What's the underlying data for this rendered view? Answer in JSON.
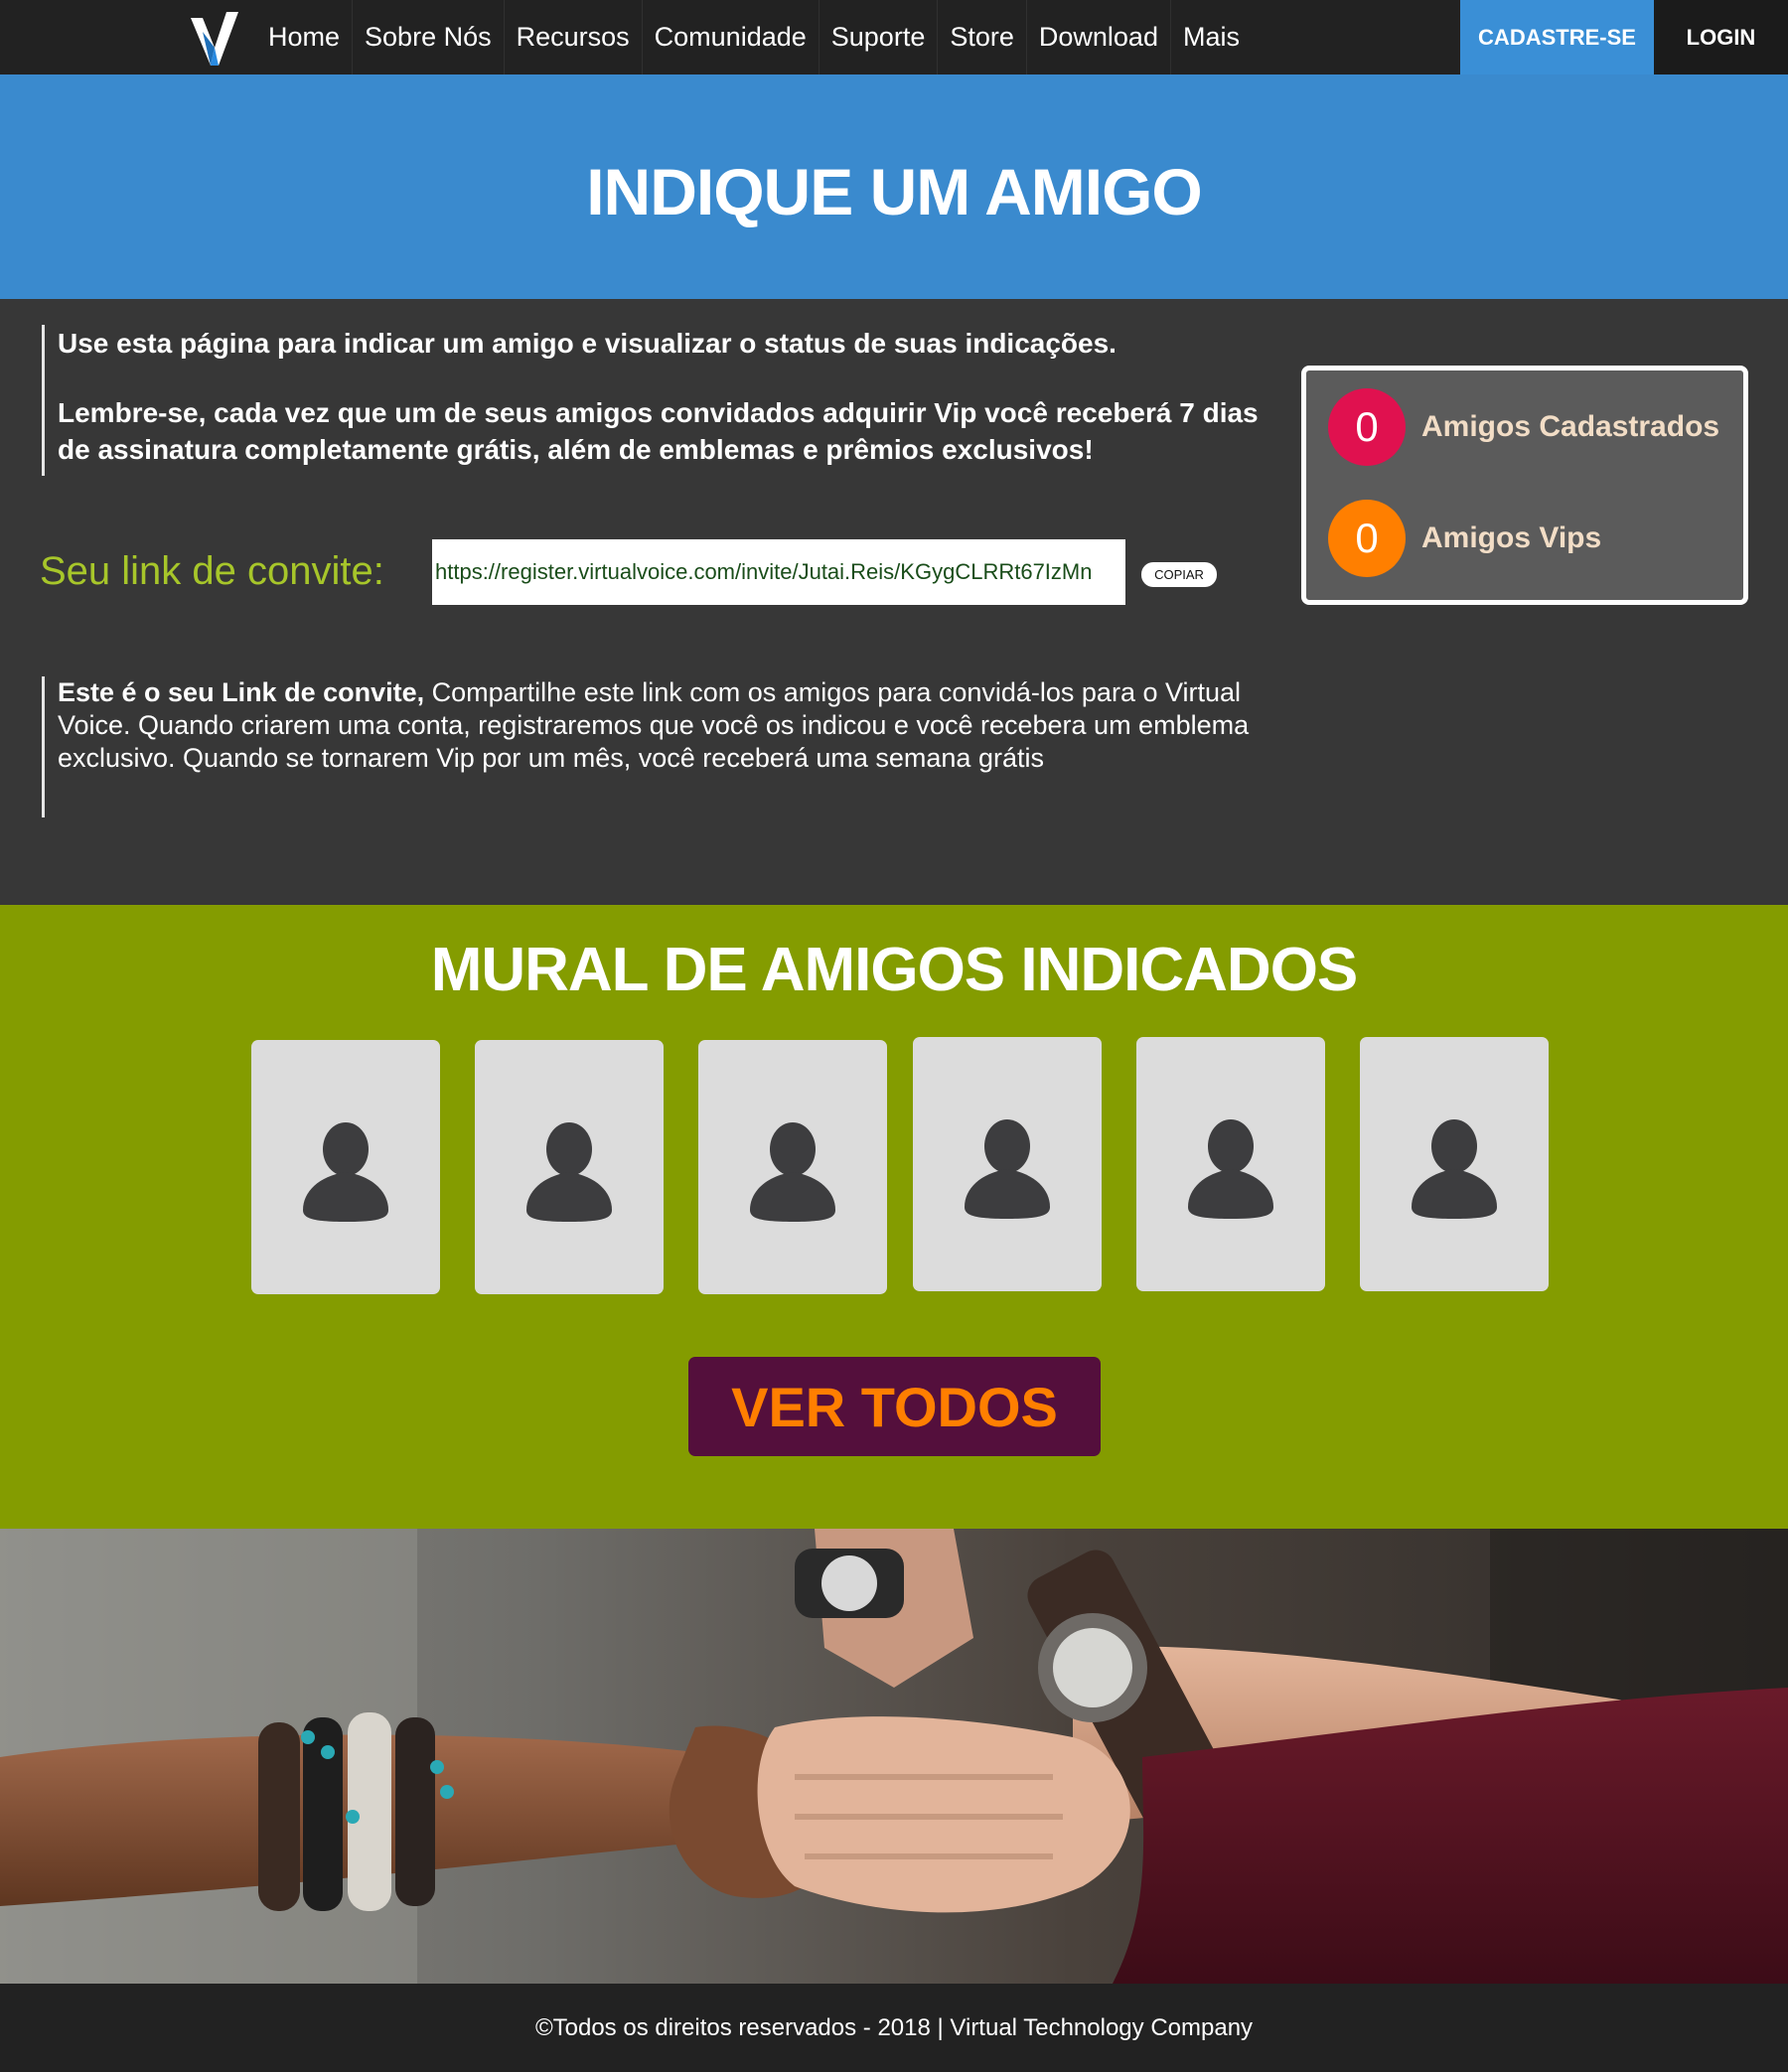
{
  "nav": {
    "items": [
      "Home",
      "Sobre Nós",
      "Recursos",
      "Comunidade",
      "Suporte",
      "Store",
      "Download",
      "Mais"
    ],
    "signup_label": "CADASTRE-SE",
    "login_label": "LOGIN"
  },
  "hero": {
    "title": "INDIQUE UM AMIGO"
  },
  "intro": {
    "line1": "Use esta página para indicar um amigo e visualizar o status de suas indicações.",
    "line2": "Lembre-se, cada vez que um de seus amigos convidados adquirir Vip você receberá 7 dias de assinatura completamente grátis, além de emblemas e prêmios exclusivos!"
  },
  "invite": {
    "label": "Seu link de convite:",
    "url": "https://register.virtualvoice.com/invite/Jutai.Reis/KGygCLRRt67IzMn",
    "copy_label": "COPIAR",
    "note_bold": "Este é o seu Link de convite,",
    "note_text": " Compartilhe este link com os amigos para convidá-los para o Virtual Voice. Quando criarem uma conta, registraremos que você os indicou e você recebera um emblema exclusivo. Quando se tornarem Vip por um mês, você receberá uma semana grátis"
  },
  "stats": {
    "registered": {
      "count": "0",
      "label": "Amigos Cadastrados",
      "color": "#e0114f"
    },
    "vips": {
      "count": "0",
      "label": "Amigos Vips",
      "color": "#ff7f00"
    }
  },
  "wall": {
    "title": "MURAL DE AMIGOS INDICADOS",
    "friend_icon": "user-silhouette-icon",
    "button_label": "VER TODOS"
  },
  "footer": {
    "text": "©Todos os direitos reservados - 2018 | Virtual Technology Company"
  },
  "colors": {
    "nav_bg": "#222222",
    "hero_bg": "#3a8ace",
    "signup_bg": "#3a8fd6",
    "info_bg": "#373737",
    "invite_label": "#a7c62a",
    "wall_bg": "#849c00",
    "button_bg": "#540f3c",
    "button_text": "#ff7f00"
  }
}
